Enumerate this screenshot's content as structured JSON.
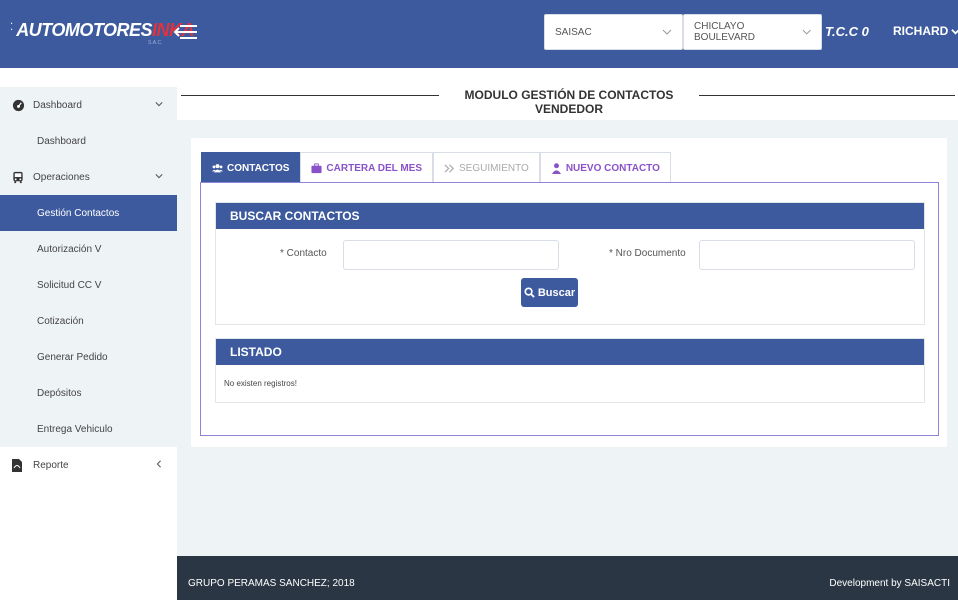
{
  "header": {
    "logo_prefix": "AUTOMOTORES",
    "logo_suffix": "INKA",
    "logo_sub": "S.A.C.",
    "empresa_select": "SAISAC",
    "sede_select": "CHICLAYO BOULEVARD",
    "tcc": "T.C.C  0",
    "user": "RICHARD"
  },
  "sidebar": {
    "items": [
      {
        "label": "Dashboard",
        "type": "parent",
        "icon": "dashboard-icon",
        "caret": "down"
      },
      {
        "label": "Dashboard",
        "type": "child"
      },
      {
        "label": "Operaciones",
        "type": "parent",
        "icon": "bus-icon",
        "caret": "down"
      },
      {
        "label": "Gestión Contactos",
        "type": "child",
        "active": true
      },
      {
        "label": "Autorización V",
        "type": "child"
      },
      {
        "label": "Solicitud CC V",
        "type": "child"
      },
      {
        "label": "Cotización",
        "type": "child"
      },
      {
        "label": "Generar Pedido",
        "type": "child"
      },
      {
        "label": "Depósitos",
        "type": "child"
      },
      {
        "label": "Entrega Vehiculo",
        "type": "child"
      },
      {
        "label": "Reporte",
        "type": "parent",
        "icon": "file-pdf-icon",
        "caret": "left"
      }
    ]
  },
  "page": {
    "title": "MODULO GESTIÓN DE CONTACTOS VENDEDOR"
  },
  "tabs": [
    {
      "label": "CONTACTOS",
      "icon": "users-icon",
      "state": "active"
    },
    {
      "label": "CARTERA DEL MES",
      "icon": "briefcase-icon",
      "state": "normal"
    },
    {
      "label": "SEGUIMIENTO",
      "icon": "double-chevron-right-icon",
      "state": "disabled"
    },
    {
      "label": "NUEVO CONTACTO",
      "icon": "user-icon",
      "state": "normal"
    }
  ],
  "search": {
    "heading": "BUSCAR CONTACTOS",
    "contacto_label": "* Contacto",
    "contacto_value": "",
    "documento_label": "* Nro Documento",
    "documento_value": "",
    "button": "Buscar"
  },
  "list": {
    "heading": "LISTADO",
    "empty": "No existen registros!"
  },
  "footer": {
    "left": "GRUPO PERAMAS SANCHEZ; 2018",
    "right": "Development by SAISACTI"
  },
  "colors": {
    "primary": "#3d5a9e",
    "footer": "#2a3644",
    "accent_purple": "#8a52c8",
    "logo_red": "#e3323b"
  }
}
